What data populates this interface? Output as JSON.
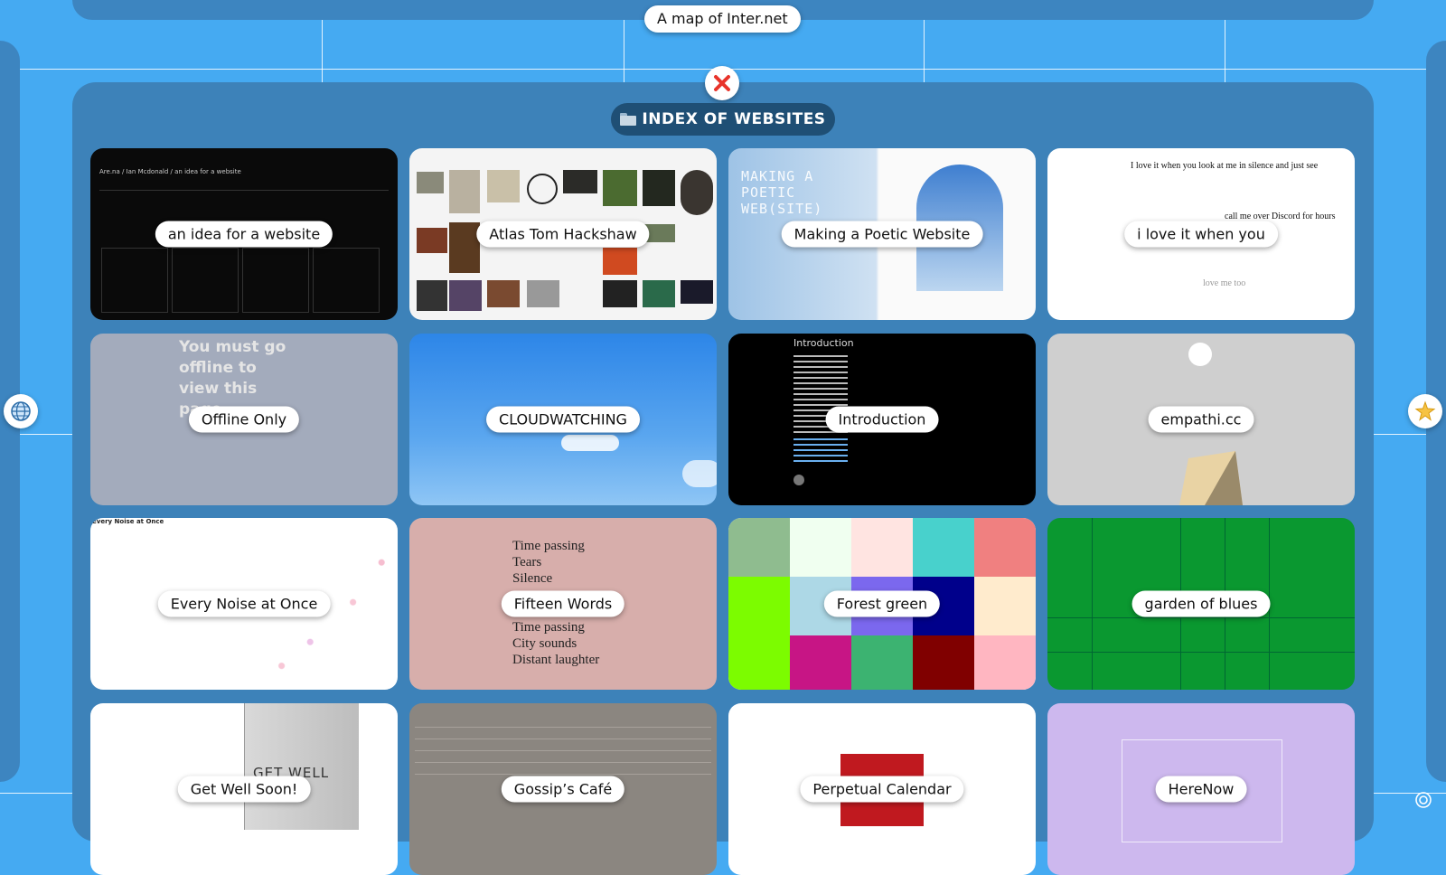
{
  "map_title": "A map of Inter.net",
  "index_title": "INDEX OF WEBSITES",
  "icons": {
    "close": "close-icon",
    "folder": "folder-icon",
    "globe": "globe-icon",
    "star": "star-icon",
    "settings": "target-icon"
  },
  "colors": {
    "background": "#45aaf2",
    "panel": "#3d82b9",
    "title_pill": "#1f4f75",
    "close_x": "#e8332a"
  },
  "websites": [
    {
      "title": "an idea for a website"
    },
    {
      "title": "Atlas Tom Hackshaw"
    },
    {
      "title": "Making a Poetic Website"
    },
    {
      "title": "i love it when you"
    },
    {
      "title": "Offline Only"
    },
    {
      "title": "CLOUDWATCHING"
    },
    {
      "title": "Introduction"
    },
    {
      "title": "empathi.cc"
    },
    {
      "title": "Every Noise at Once"
    },
    {
      "title": "Fifteen Words"
    },
    {
      "title": "Forest green"
    },
    {
      "title": "garden of blues"
    },
    {
      "title": "Get Well Soon!"
    },
    {
      "title": "Gossip’s Café"
    },
    {
      "title": "Perpetual Calendar"
    },
    {
      "title": "HereNow"
    }
  ],
  "previews": {
    "arena_breadcrumb": "Are.na / Ian Mcdonald / an idea for a website",
    "poetic_heading": "MAKING A POETIC WEB(SITE)",
    "love_line1": "I love it when you look at me in silence and just see",
    "love_line2": "call me over Discord for hours while",
    "love_line3": "love me too",
    "offline_text": "You must go offline to view this page.",
    "intro_heading": "Introduction",
    "noise_header": "Every Noise at Once",
    "fifteen_lines": [
      "Time passing",
      "Tears",
      "Silence",
      "Time passing",
      "City sounds",
      "Distant laughter"
    ],
    "getwell_text": "GET WELL"
  }
}
